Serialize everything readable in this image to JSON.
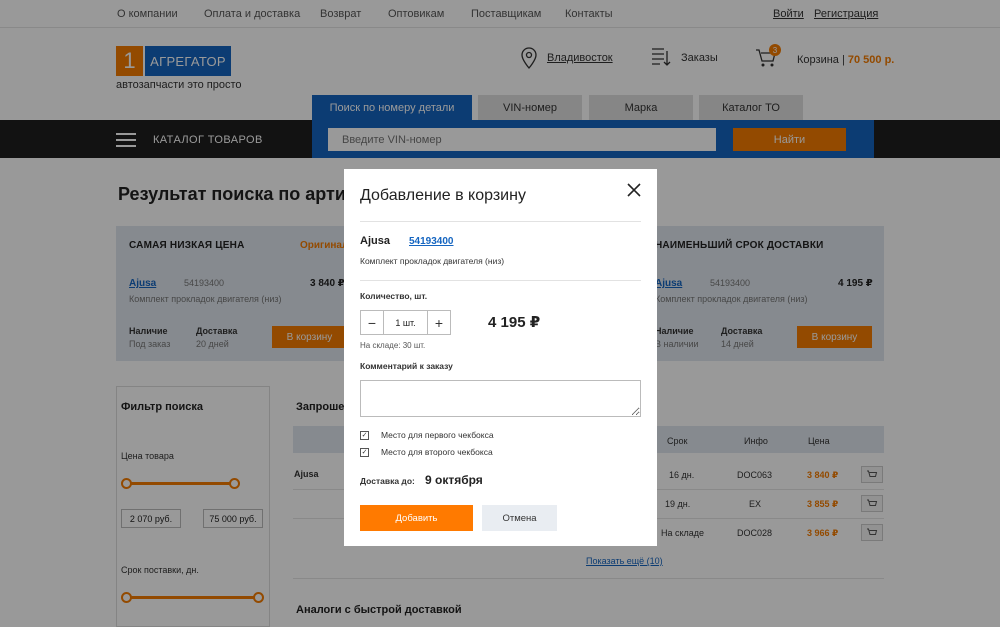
{
  "topbar": {
    "links": [
      "О компании",
      "Оплата и доставка",
      "Возврат",
      "Оптовикам",
      "Поставщикам",
      "Контакты"
    ],
    "login": "Войти",
    "register": "Регистрация"
  },
  "header": {
    "logo_num": "1",
    "logo_name": "АГРЕГАТОР",
    "logo_tagline": "автозапчасти это просто",
    "city": "Владивосток",
    "orders": "Заказы",
    "cart_badge": "3",
    "cart_label": "Корзина |",
    "cart_price": "70 500 р."
  },
  "search": {
    "tabs": [
      "Поиск по номеру детали",
      "VIN-номер",
      "Марка",
      "Каталог ТО"
    ],
    "placeholder": "Введите VIN-номер",
    "find_button": "Найти",
    "catalog_label": "КАТАЛОГ ТОВАРОВ"
  },
  "page": {
    "title": "Результат поиска по артикулу",
    "cheapest_title": "САМАЯ НИЗКАЯ ЦЕНА",
    "cheapest_badge": "Оригинал",
    "fastest_title": "НАИМЕНЬШИЙ СРОК ДОСТАВКИ",
    "offer_left": {
      "brand": "Ajusa",
      "article": "54193400",
      "price": "3 840 ₽",
      "desc": "Комплект прокладок двигателя (низ)",
      "avail_label": "Наличие",
      "avail_value": "Под заказ",
      "delivery_label": "Доставка",
      "delivery_value": "20 дней",
      "button": "В корзину"
    },
    "offer_right": {
      "brand": "Ajusa",
      "article": "54193400",
      "price": "4 195 ₽",
      "desc": "Комплект прокладок двигателя (низ)",
      "avail_label": "Наличие",
      "avail_value": "В наличии",
      "delivery_label": "Доставка",
      "delivery_value": "14 дней",
      "button": "В корзину"
    },
    "filter_title": "Фильтр поиска",
    "price_label": "Цена товара",
    "price_from": "2 070 руб.",
    "price_to": "75 000 руб.",
    "term_label": "Срок поставки, дн.",
    "requested_title": "Запрошенный артикул",
    "table_headers": [
      "Срок",
      "Инфо",
      "Цена"
    ],
    "row_brand": "Ajusa",
    "rows": [
      {
        "term": "16 дн.",
        "info": "DOC063",
        "price": "3 840 ₽"
      },
      {
        "term": "19 дн.",
        "info": "EX",
        "price": "3 855 ₽"
      },
      {
        "term": "На складе",
        "info": "DOC028",
        "price": "3 966 ₽"
      }
    ],
    "show_more": "Показать ещё (10)",
    "analogs_title": "Аналоги с быстрой доставкой"
  },
  "modal": {
    "title": "Добавление в корзину",
    "brand": "Ajusa",
    "article": "54193400",
    "description": "Комплект прокладок двигателя (низ)",
    "qty_label": "Количество, шт.",
    "qty_value": "1 шт.",
    "minus": "−",
    "plus": "+",
    "price": "4 195 ₽",
    "stock": "На складе: 30 шт.",
    "comment_label": "Комментарий к заказу",
    "checkbox1": "Место для первого чекбокса",
    "checkbox2": "Место для второго чекбокса",
    "delivery_label": "Доставка до:",
    "delivery_date": "9 октября",
    "add_button": "Добавить",
    "cancel_button": "Отмена"
  },
  "colors": {
    "accent": "#f57c00",
    "brand_blue": "#1565c0",
    "navbar": "#1e1e1e"
  }
}
